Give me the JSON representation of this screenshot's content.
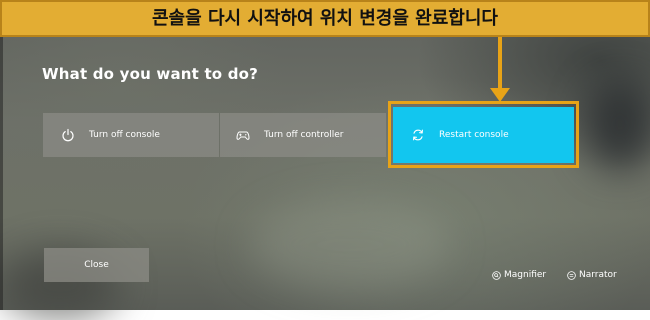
{
  "banner": {
    "text": "콘솔을 다시 시작하여 위치 변경을 완료합니다"
  },
  "dialog": {
    "heading": "What do you want to do?",
    "options": [
      {
        "label": "Turn off console",
        "icon": "power-icon"
      },
      {
        "label": "Turn off controller",
        "icon": "controller-icon"
      },
      {
        "label": "Restart console",
        "icon": "restart-icon",
        "selected": true
      }
    ],
    "close_label": "Close"
  },
  "footer": {
    "magnifier_label": "Magnifier",
    "magnifier_icon": "magnifier-icon",
    "narrator_label": "Narrator",
    "narrator_icon": "narrator-icon"
  },
  "colors": {
    "banner_background": "#e3ad33",
    "annotation_orange": "#e8a317",
    "selected_tile": "#12c6ef",
    "tile_background": "#8c8c86",
    "text": "#ffffff"
  }
}
